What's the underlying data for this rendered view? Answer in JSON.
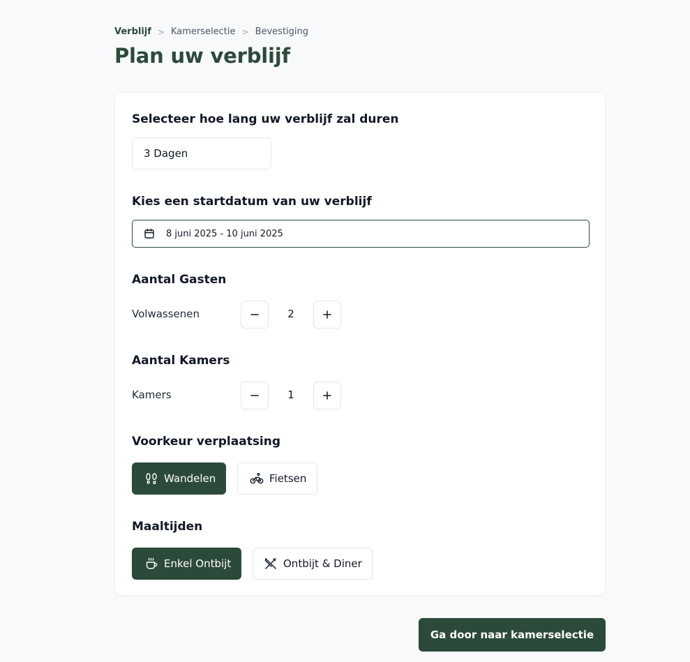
{
  "breadcrumb": {
    "items": [
      {
        "label": "Verblijf",
        "active": true
      },
      {
        "label": "Kamerselectie",
        "active": false
      },
      {
        "label": "Bevestiging",
        "active": false
      }
    ],
    "separator": ">"
  },
  "page": {
    "title": "Plan uw verblijf"
  },
  "duration": {
    "title": "Selecteer hoe lang uw verblijf zal duren",
    "value": "3 Dagen"
  },
  "start_date": {
    "title": "Kies een startdatum van uw verblijf",
    "value": "8 juni 2025 - 10 juni 2025",
    "icon": "calendar-icon"
  },
  "guests": {
    "title": "Aantal Gasten",
    "label": "Volwassenen",
    "count": "2"
  },
  "rooms": {
    "title": "Aantal Kamers",
    "label": "Kamers",
    "count": "1"
  },
  "transport": {
    "title": "Voorkeur verplaatsing",
    "options": [
      {
        "label": "Wandelen",
        "icon": "footprints-icon",
        "selected": true
      },
      {
        "label": "Fietsen",
        "icon": "bicycle-icon",
        "selected": false
      }
    ]
  },
  "meals": {
    "title": "Maaltijden",
    "options": [
      {
        "label": "Enkel Ontbijt",
        "icon": "coffee-cup-icon",
        "selected": true
      },
      {
        "label": "Ontbijt & Diner",
        "icon": "utensils-crossed-icon",
        "selected": false
      }
    ]
  },
  "cta": {
    "label": "Ga door naar kamerselectie"
  },
  "colors": {
    "brand": "#2c4a3a",
    "background": "#f8f9fb",
    "card": "#ffffff",
    "border": "#e2e5e9"
  }
}
